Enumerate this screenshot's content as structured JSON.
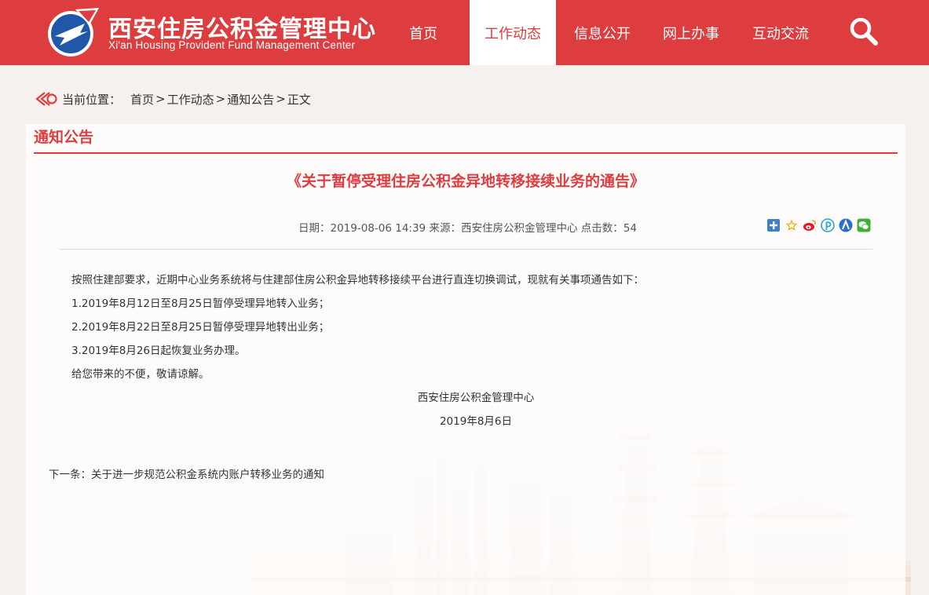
{
  "colors": {
    "brand_red": "#de3d3f",
    "white": "#ffffff"
  },
  "header": {
    "logo_cn": "西安住房公积金管理中心",
    "logo_en": "Xi'an Housing Provident Fund  Management Center",
    "logo_icon": "housing-fund-logo-icon",
    "nav": [
      {
        "label": "首页",
        "active": false
      },
      {
        "label": "工作动态",
        "active": true
      },
      {
        "label": "信息公开",
        "active": false
      },
      {
        "label": "网上办事",
        "active": false
      },
      {
        "label": "互动交流",
        "active": false
      }
    ],
    "search_icon": "search-icon"
  },
  "breadcrumb": {
    "icon": "location-arrow-icon",
    "prefix": "当前位置：",
    "items": [
      "首页",
      "工作动态",
      "通知公告",
      "正文"
    ],
    "separator": ">"
  },
  "section": {
    "title": "通知公告"
  },
  "article": {
    "title": "《关于暂停受理住房公积金异地转移接续业务的通告》",
    "meta": "日期：2019-08-06 14:39 来源：西安住房公积金管理中心 点击数：54",
    "share_icons": [
      "qzone-icon",
      "favorite-star-icon",
      "weibo-icon",
      "pinterest-icon",
      "baidu-icon",
      "wechat-icon"
    ],
    "paragraphs": [
      "按照住建部要求，近期中心业务系统将与住建部住房公积金异地转移接续平台进行直连切换调试，现就有关事项通告如下：",
      "1.2019年8月12日至8月25日暂停受理异地转入业务；",
      "2.2019年8月22日至8月25日暂停受理异地转出业务；",
      "3.2019年8月26日起恢复业务办理。",
      "给您带来的不便，敬请谅解。"
    ],
    "signature": "西安住房公积金管理中心",
    "date": "2019年8月6日"
  },
  "next": {
    "prefix": "下一条：",
    "title": "关于进一步规范公积金系统内账户转移业务的通知"
  }
}
